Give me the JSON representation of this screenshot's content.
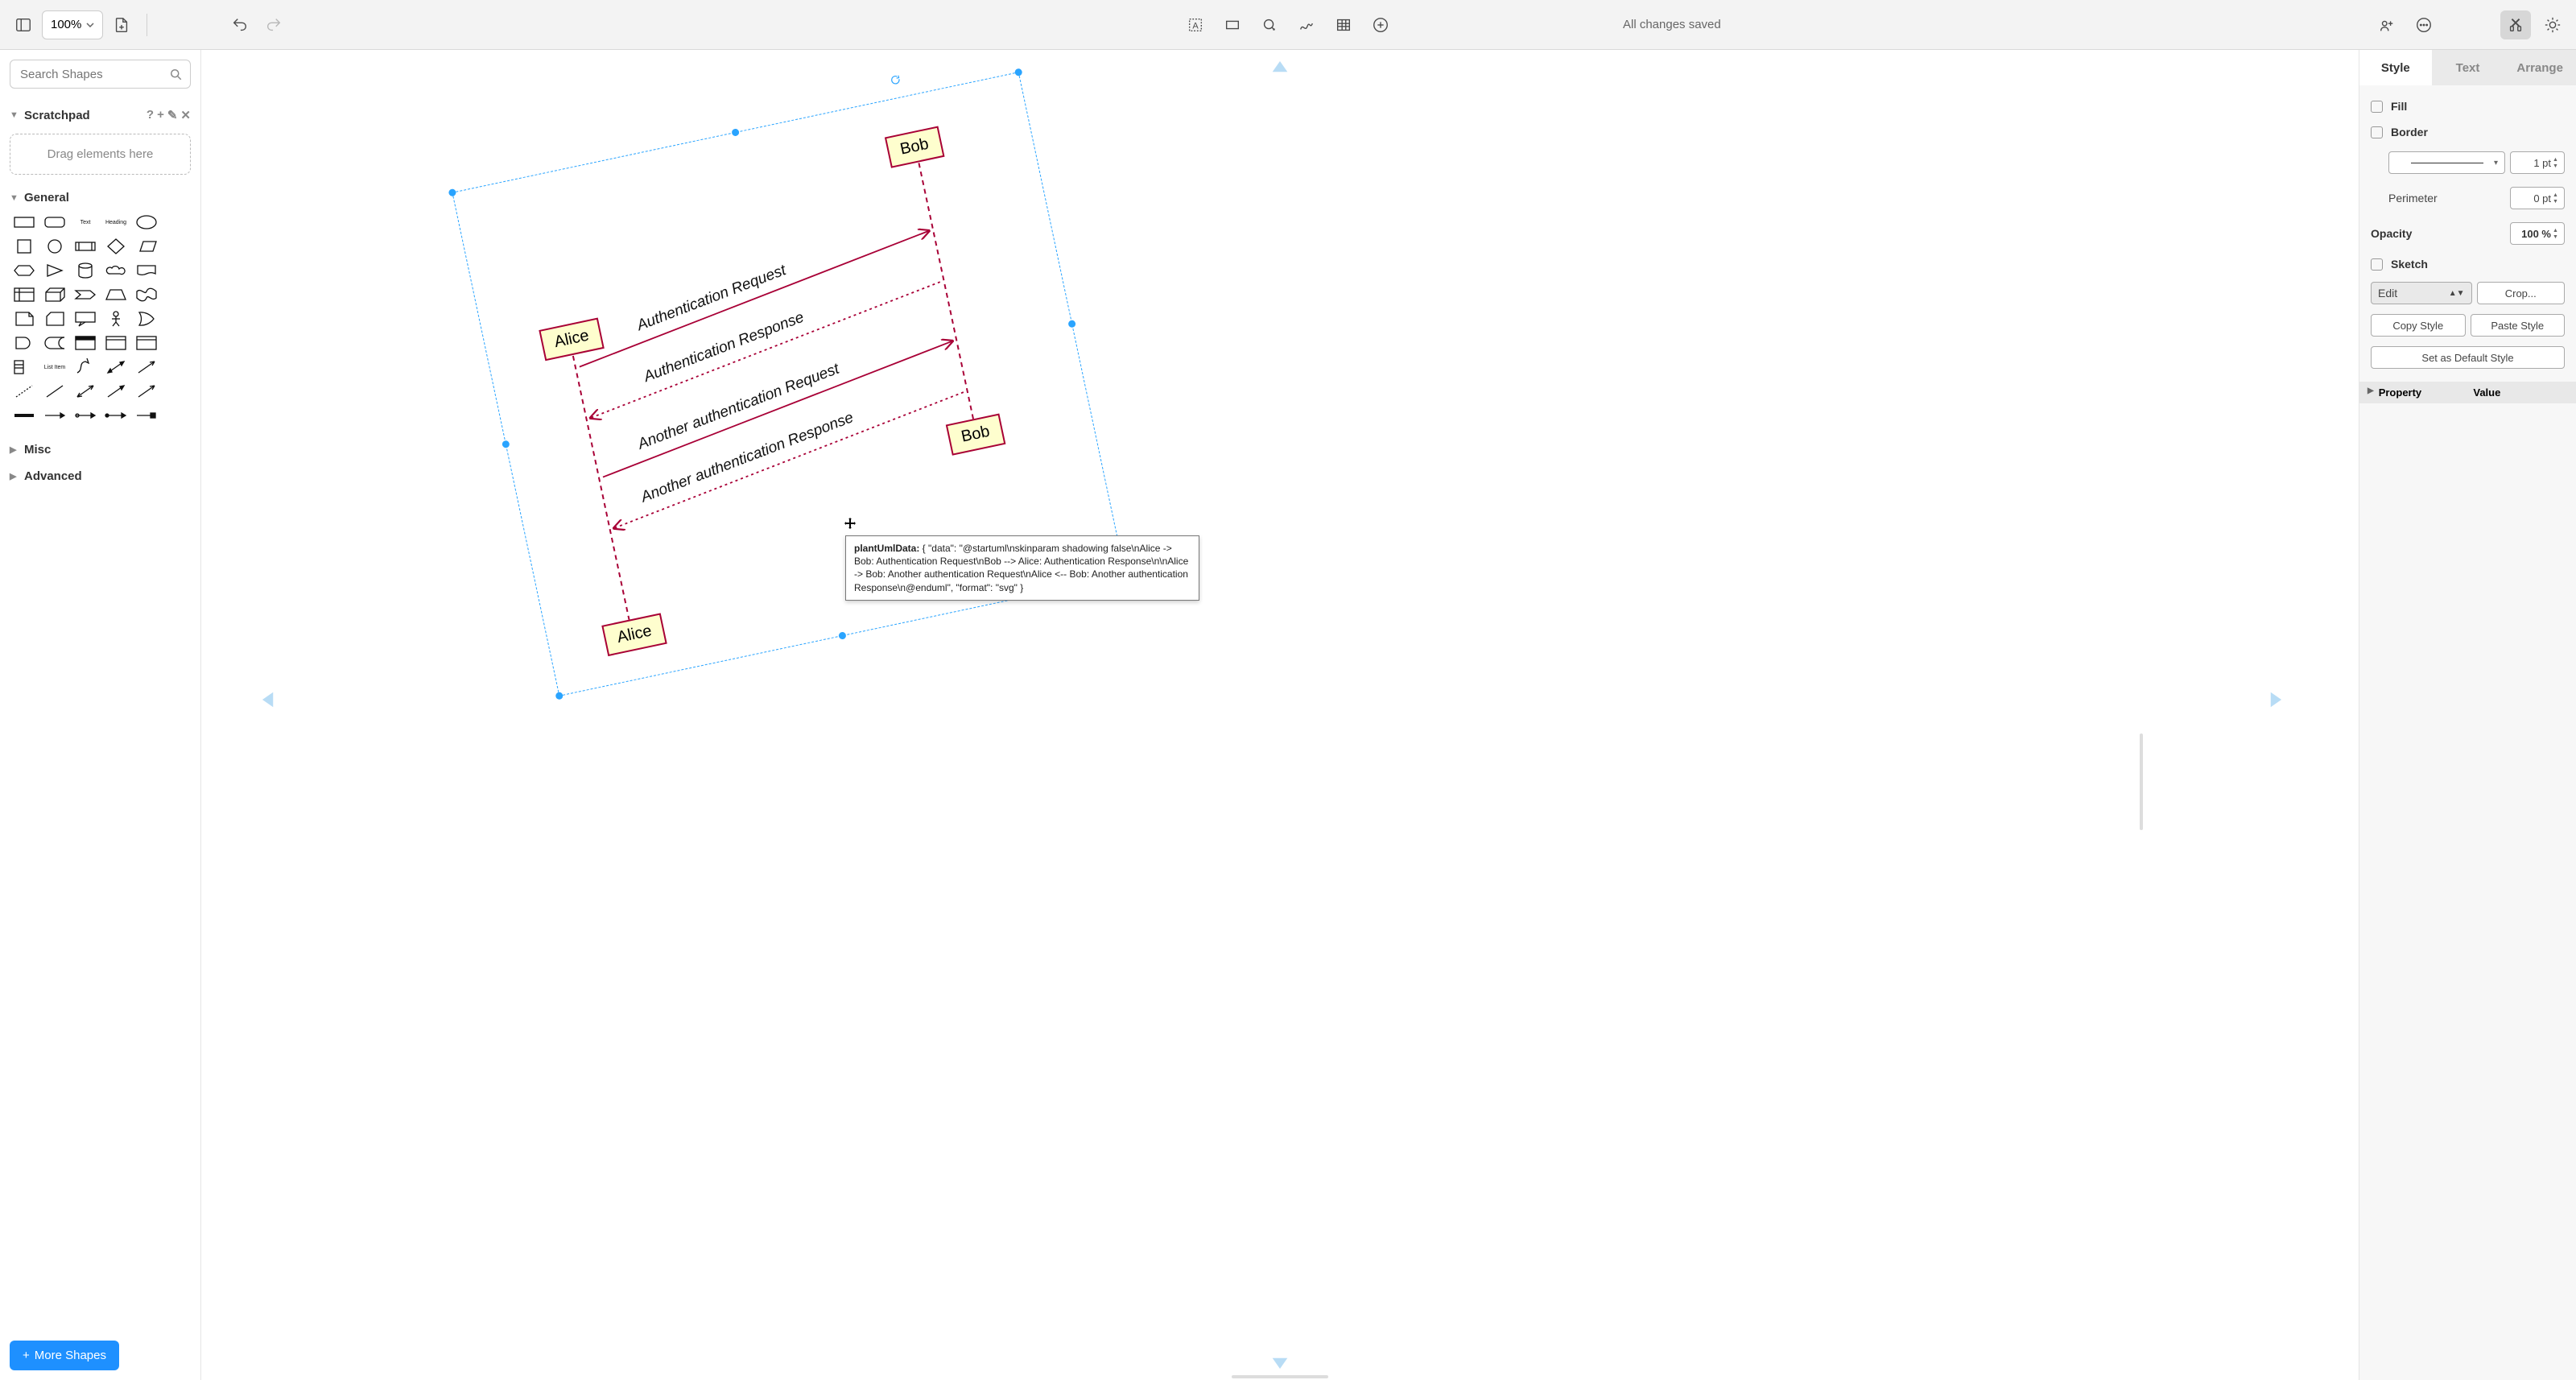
{
  "toolbar": {
    "zoom": "100%",
    "status": "All changes saved"
  },
  "sidebar": {
    "search_placeholder": "Search Shapes",
    "scratchpad": {
      "title": "Scratchpad",
      "hint": "Drag elements here"
    },
    "general": "General",
    "misc": "Misc",
    "advanced": "Advanced",
    "more_shapes": "More Shapes"
  },
  "canvas": {
    "actors": {
      "alice": "Alice",
      "bob": "Bob"
    },
    "messages": {
      "m1": "Authentication Request",
      "m2": "Authentication Response",
      "m3": "Another authentication Request",
      "m4": "Another authentication Response"
    },
    "tooltip": {
      "label": "plantUmlData:",
      "body": " { \"data\": \"@startuml\\nskinparam shadowing false\\nAlice -> Bob: Authentication Request\\nBob --> Alice: Authentication Response\\n\\nAlice -> Bob: Another authentication Request\\nAlice <-- Bob: Another authentication Response\\n@enduml\", \"format\": \"svg\" }"
    }
  },
  "right": {
    "tabs": {
      "style": "Style",
      "text": "Text",
      "arrange": "Arrange"
    },
    "fill": "Fill",
    "border": "Border",
    "border_width": "1 pt",
    "perimeter": "Perimeter",
    "perimeter_val": "0 pt",
    "opacity": "Opacity",
    "opacity_val": "100 %",
    "sketch": "Sketch",
    "edit": "Edit",
    "crop": "Crop...",
    "copy_style": "Copy Style",
    "paste_style": "Paste Style",
    "set_default": "Set as Default Style",
    "property": "Property",
    "value": "Value"
  }
}
